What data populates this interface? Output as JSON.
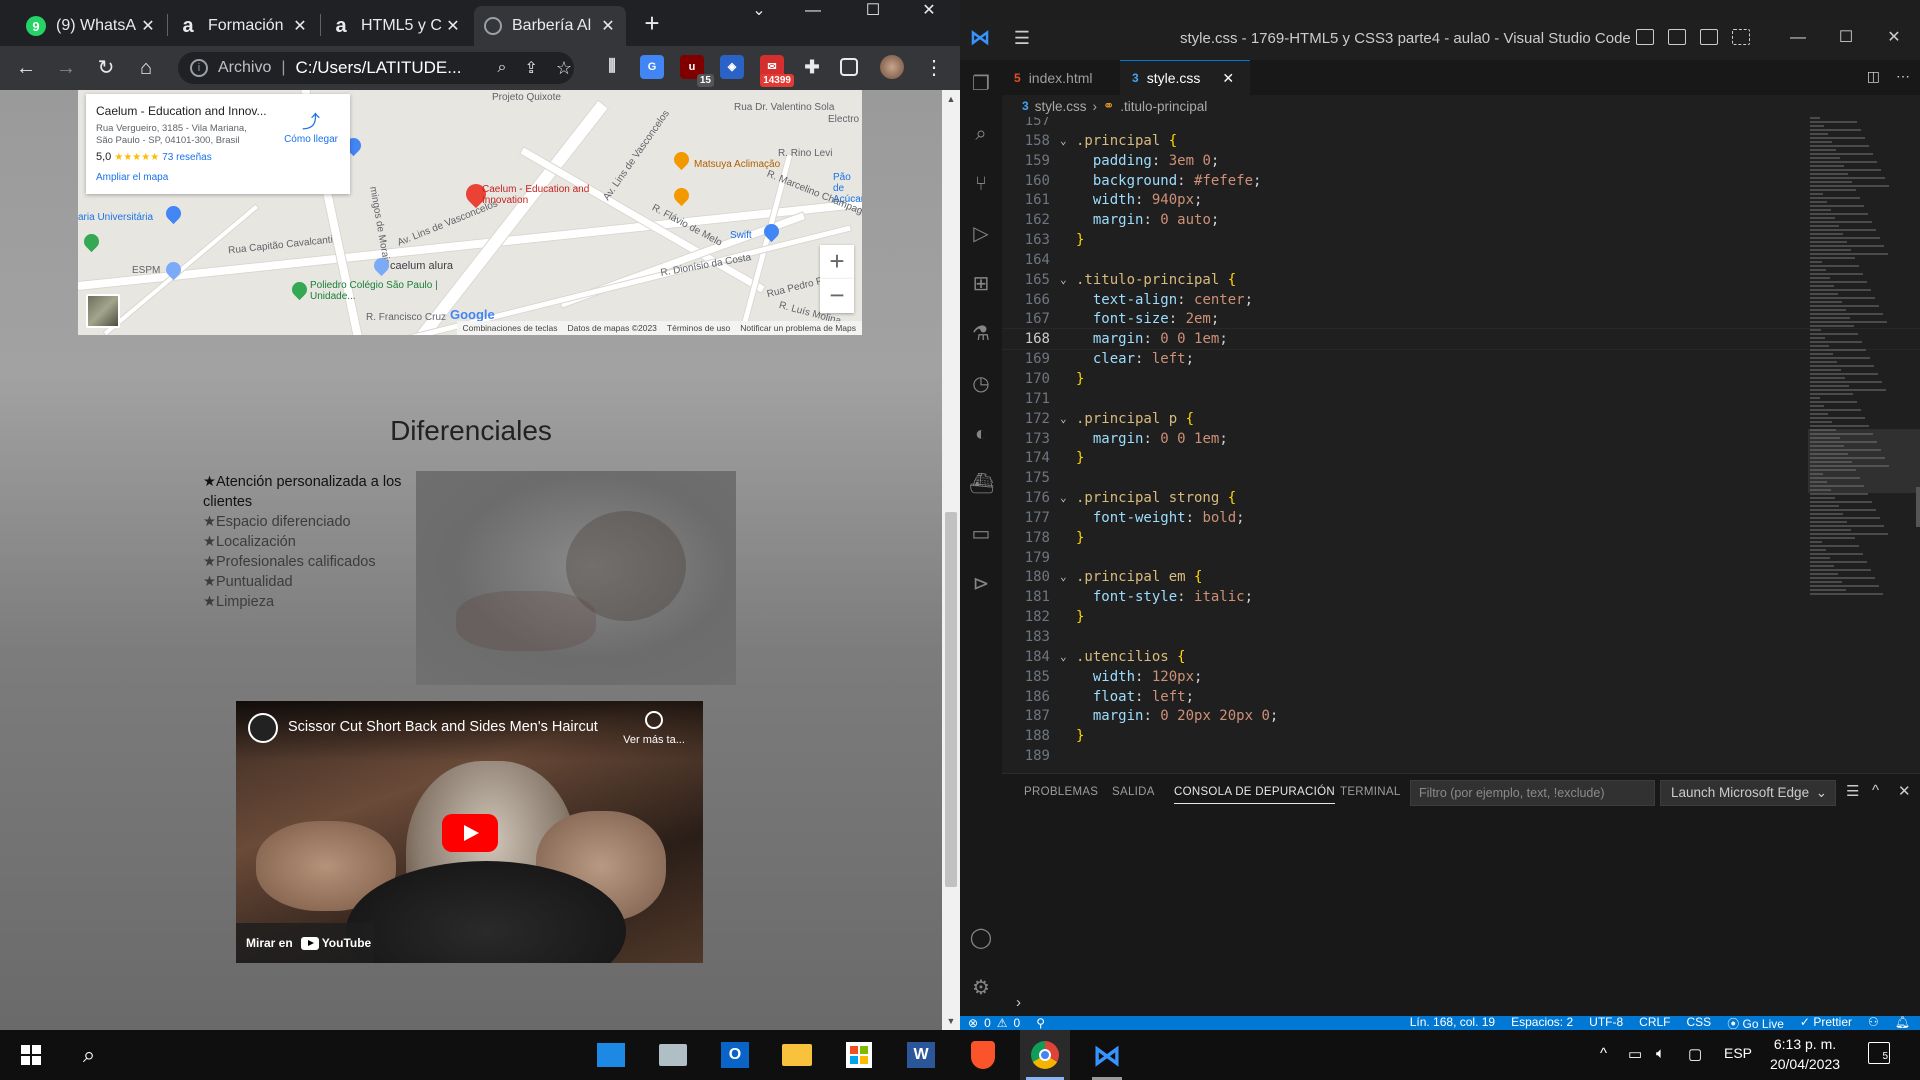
{
  "browser": {
    "tabs": [
      {
        "title": "(9) WhatsA",
        "icon": "whatsapp-icon",
        "icon_color": "#25d366",
        "active": false
      },
      {
        "title": "Formación",
        "icon": "alura-icon",
        "icon_color": "#051933",
        "active": false
      },
      {
        "title": "HTML5 y C",
        "icon": "alura-icon",
        "icon_color": "#051933",
        "active": false
      },
      {
        "title": "Barbería Al",
        "icon": "globe-icon",
        "icon_color": "#9aa0a6",
        "active": true
      }
    ],
    "address": {
      "scheme_label": "Archivo",
      "url": "C:/Users/LATITUDE..."
    },
    "extensions": {
      "ublock_badge": "15",
      "mail_badge": "14399"
    }
  },
  "map": {
    "place_name": "Caelum - Education and Innov...",
    "address": "Rua Vergueiro, 3185 - Vila Mariana, São Paulo - SP, 04101-300, Brasil",
    "rating": "5,0",
    "stars": "★★★★★",
    "reviews": "73 reseñas",
    "directions": "Cómo llegar",
    "expand": "Ampliar el mapa",
    "pin_label": "Caelum - Education and Innovation",
    "labels": [
      "Projeto Quixote",
      "Av. Lins de Vasconcelos",
      "Rua Dr. Valentino Sola",
      "Electro",
      "Matsuya Aclimação",
      "R. Rino Levi",
      "Pão de Açúcar",
      "R. Marcelino Champagnat",
      "aria Universitária",
      "R. Flávio de Melo",
      "Swift",
      "Rua Capitão Cavalcanti",
      "Av. Lins de Vasconcelos",
      "ESPM",
      "caelum alura",
      "R. Dionísio da Costa",
      "Rua Pedro Pomp",
      "Poliedro Colégio São Paulo | Unidade...",
      "R. Francisco Cruz",
      "R. Luís Molina",
      "mingos de Morais"
    ],
    "google": "Google",
    "footer": [
      "Combinaciones de teclas",
      "Datos de mapas ©2023",
      "Términos de uso",
      "Notificar un problema de Maps"
    ]
  },
  "page": {
    "title": "Diferenciales",
    "items": [
      "★Atención personalizada a los clientes",
      "★Espacio diferenciado",
      "★Localización",
      "★Profesionales calificados",
      "★Puntualidad",
      "★Limpieza"
    ],
    "video": {
      "title": "Scissor Cut Short Back and Sides Men's Haircut",
      "watch_later": "Ver más ta...",
      "watch_on": "Mirar en",
      "youtube": "YouTube"
    }
  },
  "vscode": {
    "window_title": "style.css - 1769-HTML5 y CSS3 parte4 - aula0 - Visual Studio Code",
    "tabs": [
      {
        "name": "index.html",
        "active": false
      },
      {
        "name": "style.css",
        "active": true
      }
    ],
    "breadcrumb": {
      "file": "style.css",
      "symbol": ".titulo-principal"
    },
    "current_line": 168,
    "lines": [
      {
        "n": 157,
        "t": ""
      },
      {
        "n": 158,
        "t": ".principal {",
        "fold": true
      },
      {
        "n": 159,
        "t": "  padding: 3em 0;"
      },
      {
        "n": 160,
        "t": "  background: #fefefe;"
      },
      {
        "n": 161,
        "t": "  width: 940px;"
      },
      {
        "n": 162,
        "t": "  margin: 0 auto;"
      },
      {
        "n": 163,
        "t": "}"
      },
      {
        "n": 164,
        "t": ""
      },
      {
        "n": 165,
        "t": ".titulo-principal {",
        "fold": true
      },
      {
        "n": 166,
        "t": "  text-align: center;"
      },
      {
        "n": 167,
        "t": "  font-size: 2em;"
      },
      {
        "n": 168,
        "t": "  margin: 0 0 1em;"
      },
      {
        "n": 169,
        "t": "  clear: left;"
      },
      {
        "n": 170,
        "t": "}"
      },
      {
        "n": 171,
        "t": ""
      },
      {
        "n": 172,
        "t": ".principal p {",
        "fold": true
      },
      {
        "n": 173,
        "t": "  margin: 0 0 1em;"
      },
      {
        "n": 174,
        "t": "}"
      },
      {
        "n": 175,
        "t": ""
      },
      {
        "n": 176,
        "t": ".principal strong {",
        "fold": true
      },
      {
        "n": 177,
        "t": "  font-weight: bold;"
      },
      {
        "n": 178,
        "t": "}"
      },
      {
        "n": 179,
        "t": ""
      },
      {
        "n": 180,
        "t": ".principal em {",
        "fold": true
      },
      {
        "n": 181,
        "t": "  font-style: italic;"
      },
      {
        "n": 182,
        "t": "}"
      },
      {
        "n": 183,
        "t": ""
      },
      {
        "n": 184,
        "t": ".utencilios {",
        "fold": true
      },
      {
        "n": 185,
        "t": "  width: 120px;"
      },
      {
        "n": 186,
        "t": "  float: left;"
      },
      {
        "n": 187,
        "t": "  margin: 0 20px 20px 0;"
      },
      {
        "n": 188,
        "t": "}"
      },
      {
        "n": 189,
        "t": ""
      }
    ],
    "panel": {
      "tabs": [
        "PROBLEMAS",
        "SALIDA",
        "CONSOLA DE DEPURACIÓN",
        "TERMINAL"
      ],
      "active_tab": "CONSOLA DE DEPURACIÓN",
      "filter_placeholder": "Filtro (por ejemplo, text, !exclude)",
      "launch": "Launch Microsoft Edge"
    },
    "status": {
      "errors": "0",
      "warnings": "0",
      "position": "Lín. 168, col. 19",
      "spaces": "Espacios: 2",
      "encoding": "UTF-8",
      "eol": "CRLF",
      "language": "CSS",
      "golive": "Go Live",
      "prettier": "Prettier"
    }
  },
  "taskbar": {
    "language": "ESP",
    "time": "6:13 p. m.",
    "date": "20/04/2023",
    "notifications": "5"
  }
}
